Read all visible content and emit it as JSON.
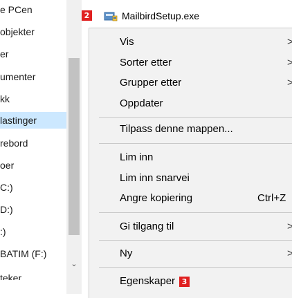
{
  "nav": {
    "items": [
      {
        "label": "e PCen",
        "selected": false
      },
      {
        "label": "objekter",
        "selected": false
      },
      {
        "label": "er",
        "selected": false
      },
      {
        "label": "umenter",
        "selected": false
      },
      {
        "label": "kk",
        "selected": false
      },
      {
        "label": "lastinger",
        "selected": true
      },
      {
        "label": "rebord",
        "selected": false
      },
      {
        "label": "oer",
        "selected": false
      },
      {
        "label": "C:)",
        "selected": false
      },
      {
        "label": "D:)",
        "selected": false
      },
      {
        "label": ":)",
        "selected": false
      },
      {
        "label": "BATIM (F:)",
        "selected": false
      },
      {
        "label": "teker",
        "selected": false
      }
    ],
    "scroll_down_icon": "chevron-down-icon"
  },
  "file": {
    "badge": "2",
    "name": "MailbirdSetup.exe",
    "icon": "installer-icon"
  },
  "menu": {
    "items": {
      "view": "Vis",
      "sort": "Sorter etter",
      "group": "Grupper etter",
      "refresh": "Oppdater",
      "customize": "Tilpass denne mappen...",
      "paste": "Lim inn",
      "paste_shortcut": "Lim inn snarvei",
      "undo_copy": "Angre kopiering",
      "undo_copy_shortcut": "Ctrl+Z",
      "give_access": "Gi tilgang til",
      "new": "Ny",
      "properties": "Egenskaper"
    },
    "properties_badge": "3",
    "submenu_arrow": ">"
  },
  "colors": {
    "selection": "#cce8ff",
    "menu_bg": "#f2f2f2",
    "badge": "#e02020"
  }
}
